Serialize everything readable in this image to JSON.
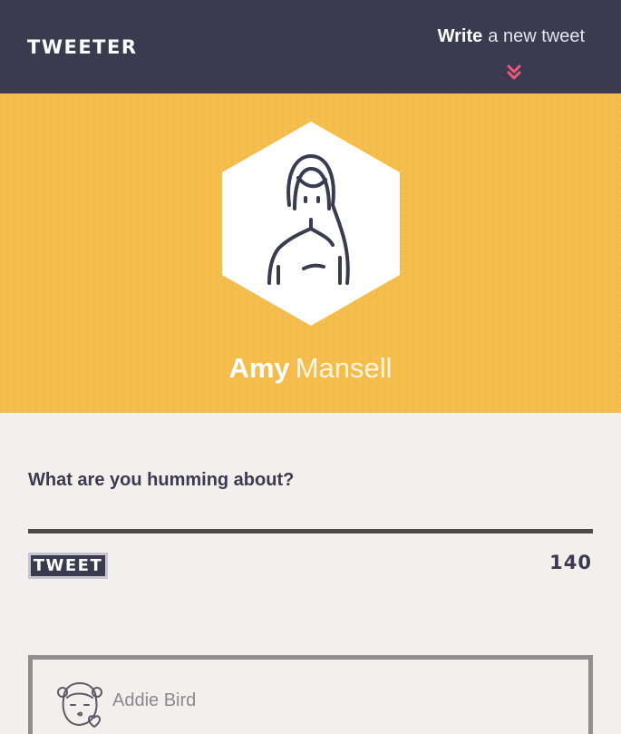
{
  "header": {
    "logo": "Tweeter",
    "write_strong": "Write",
    "write_rest": "a new tweet",
    "chevron_icon": "double-chevron-down-icon"
  },
  "profile": {
    "first_name": "Amy",
    "last_name": "Mansell",
    "avatar_icon": "woman-avatar-icon"
  },
  "composer": {
    "prompt": "What are you humming about?",
    "input_value": "",
    "tweet_button": "Tweet",
    "char_count": "140"
  },
  "tweets": [
    {
      "author": "Addie Bird",
      "avatar_icon": "kissing-girl-avatar-icon"
    }
  ],
  "colors": {
    "header_bg": "#3b3a4f",
    "hero_bg": "#f4bd4b",
    "accent_pink": "#f05a78",
    "page_bg": "#f2f0ec"
  }
}
